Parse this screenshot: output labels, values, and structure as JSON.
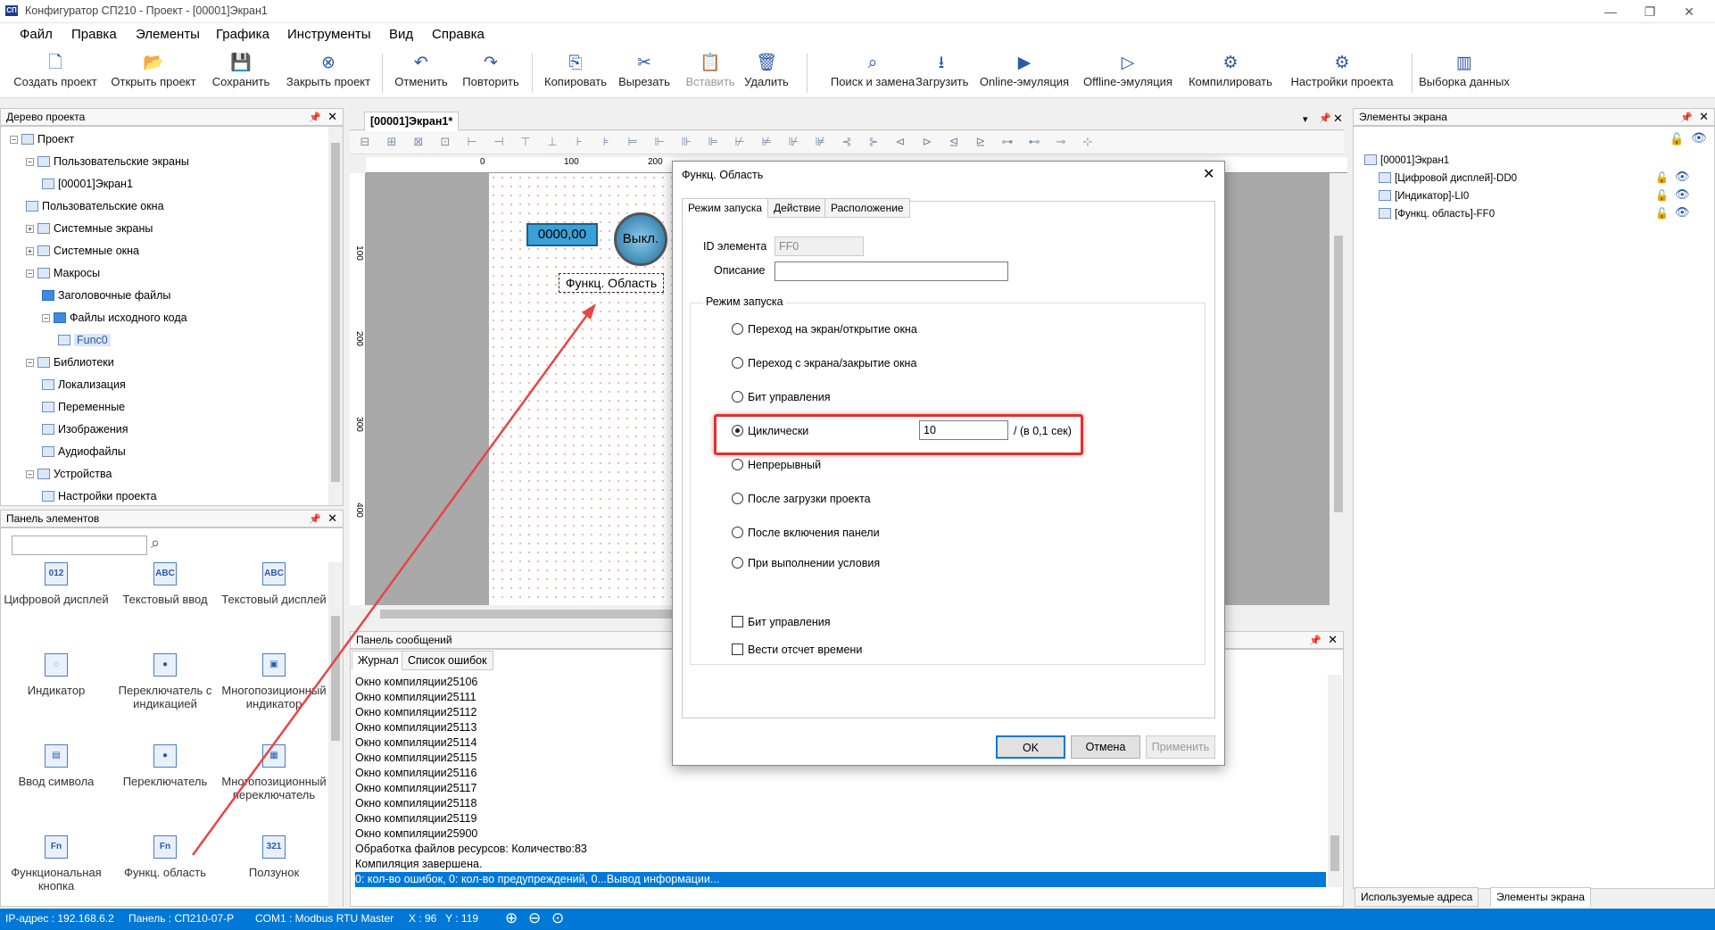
{
  "window": {
    "title": "Конфигуратор СП210 - Проект - [00001]Экран1",
    "app_icon": "СП",
    "controls": [
      "—",
      "❐",
      "✕"
    ]
  },
  "menu": [
    "Файл",
    "Правка",
    "Элементы",
    "Графика",
    "Инструменты",
    "Вид",
    "Справка"
  ],
  "toolbar": [
    {
      "label": "Создать проект",
      "icon": "new-project-icon",
      "glyph": "🗋"
    },
    {
      "label": "Открыть проект",
      "icon": "open-project-icon",
      "glyph": "📂"
    },
    {
      "label": "Сохранить",
      "icon": "save-icon",
      "glyph": "💾"
    },
    {
      "label": "Закрыть проект",
      "icon": "close-project-icon",
      "glyph": "⊗"
    },
    {
      "label": "Отменить",
      "icon": "undo-icon",
      "glyph": "↶"
    },
    {
      "label": "Повторить",
      "icon": "redo-icon",
      "glyph": "↷"
    },
    {
      "label": "Копировать",
      "icon": "copy-icon",
      "glyph": "⎘"
    },
    {
      "label": "Вырезать",
      "icon": "cut-icon",
      "glyph": "✂"
    },
    {
      "label": "Вставить",
      "icon": "paste-icon",
      "glyph": "📋",
      "disabled": true
    },
    {
      "label": "Удалить",
      "icon": "delete-icon",
      "glyph": "🗑"
    },
    {
      "label": "Поиск и замена",
      "icon": "search-replace-icon",
      "glyph": "⌕"
    },
    {
      "label": "Загрузить",
      "icon": "download-icon",
      "glyph": "⭳"
    },
    {
      "label": "Online-эмуляция",
      "icon": "online-emulation-icon",
      "glyph": "▶"
    },
    {
      "label": "Offline-эмуляция",
      "icon": "offline-emulation-icon",
      "glyph": "▷"
    },
    {
      "label": "Компилировать",
      "icon": "compile-icon",
      "glyph": "⚙"
    },
    {
      "label": "Настройки проекта",
      "icon": "project-settings-icon",
      "glyph": "⚙"
    },
    {
      "label": "Выборка данных",
      "icon": "data-sampling-icon",
      "glyph": "▥"
    }
  ],
  "project_tree": {
    "title": "Дерево проекта",
    "items": [
      {
        "label": "Проект",
        "level": 0,
        "expanded": true,
        "folder": false
      },
      {
        "label": "Пользовательские экраны",
        "level": 1,
        "expanded": true,
        "folder": false
      },
      {
        "label": "[00001]Экран1",
        "level": 2,
        "folder": false
      },
      {
        "label": "Пользовательские окна",
        "level": 1,
        "folder": false
      },
      {
        "label": "Системные экраны",
        "level": 1,
        "expanded": false,
        "folder": false
      },
      {
        "label": "Системные окна",
        "level": 1,
        "expanded": false,
        "folder": false
      },
      {
        "label": "Макросы",
        "level": 1,
        "expanded": true,
        "folder": false
      },
      {
        "label": "Заголовочные файлы",
        "level": 2,
        "folder": true
      },
      {
        "label": "Файлы исходного кода",
        "level": 2,
        "expanded": true,
        "folder": true
      },
      {
        "label": "Func0",
        "level": 3,
        "folder": false,
        "selected": true
      },
      {
        "label": "Библиотеки",
        "level": 1,
        "expanded": true,
        "folder": false
      },
      {
        "label": "Локализация",
        "level": 2,
        "folder": false
      },
      {
        "label": "Переменные",
        "level": 2,
        "folder": false
      },
      {
        "label": "Изображения",
        "level": 2,
        "folder": false
      },
      {
        "label": "Аудиофайлы",
        "level": 2,
        "folder": false
      },
      {
        "label": "Устройства",
        "level": 1,
        "expanded": true,
        "folder": false
      },
      {
        "label": "Настройки проекта",
        "level": 2,
        "folder": false
      }
    ]
  },
  "elements_panel": {
    "title": "Панель элементов",
    "search_placeholder": "",
    "items": [
      {
        "label": "Цифровой дисплей",
        "icon": "digital-display-icon",
        "glyph": "012"
      },
      {
        "label": "Текстовый ввод",
        "icon": "text-input-icon",
        "glyph": "ABC"
      },
      {
        "label": "Текстовый дисплей",
        "icon": "text-display-icon",
        "glyph": "ABC"
      },
      {
        "label": "Индикатор",
        "icon": "indicator-bulb-icon",
        "glyph": "◌"
      },
      {
        "label": "Переключатель с индикацией",
        "icon": "switch-indicator-icon",
        "glyph": "●"
      },
      {
        "label": "Многопозиционный индикатор",
        "icon": "multi-indicator-icon",
        "glyph": "▣"
      },
      {
        "label": "Ввод символа",
        "icon": "symbol-input-icon",
        "glyph": "▤"
      },
      {
        "label": "Переключатель",
        "icon": "switch-icon",
        "glyph": "●"
      },
      {
        "label": "Многопозиционный переключатель",
        "icon": "multi-switch-icon",
        "glyph": "▦"
      },
      {
        "label": "Функциональная кнопка",
        "icon": "function-button-icon",
        "glyph": "Fn"
      },
      {
        "label": "Функц. область",
        "icon": "function-area-icon",
        "glyph": "Fn"
      },
      {
        "label": "Ползунок",
        "icon": "slider-icon",
        "glyph": "321"
      }
    ]
  },
  "editor": {
    "tab": "[00001]Экран1*",
    "ruler_marks": [
      "0",
      "100",
      "200"
    ],
    "vruler_marks": [
      "100",
      "200",
      "300",
      "400"
    ],
    "digital_display_value": "0000,00",
    "switch_label": "Выкл.",
    "function_area_label": "Функц. Область"
  },
  "messages": {
    "title": "Панель сообщений",
    "tabs": [
      "Журнал",
      "Список ошибок"
    ],
    "lines": [
      "Окно компиляции25106",
      "Окно компиляции25111",
      "Окно компиляции25112",
      "Окно компиляции25113",
      "Окно компиляции25114",
      "Окно компиляции25115",
      "Окно компиляции25116",
      "Окно компиляции25117",
      "Окно компиляции25118",
      "Окно компиляции25119",
      "Окно компиляции25900",
      "Обработка файлов ресурсов: Количество:83",
      "Компиляция завершена.",
      "0: кол-во ошибок, 0: кол-во предупреждений, 0...Вывод информации..."
    ]
  },
  "screen_elements": {
    "title": "Элементы экрана",
    "items": [
      {
        "label": "[00001]Экран1",
        "level": 0
      },
      {
        "label": "[Цифровой дисплей]-DD0",
        "level": 1
      },
      {
        "label": "[Индикатор]-LI0",
        "level": 1
      },
      {
        "label": "[Функц. область]-FF0",
        "level": 1
      }
    ],
    "bottom_tabs": [
      "Используемые адреса",
      "Элементы экрана"
    ]
  },
  "dialog": {
    "title": "Функц. Область",
    "tabs": [
      "Режим запуска",
      "Действие",
      "Расположение"
    ],
    "id_label": "ID элемента",
    "id_value": "FF0",
    "desc_label": "Описание",
    "desc_value": "",
    "group_label": "Режим запуска",
    "options": [
      "Переход на экран/открытие окна",
      "Переход с экрана/закрытие окна",
      "Бит управления",
      "Циклически",
      "Непрерывный",
      "После загрузки проекта",
      "После включения панели",
      "При выполнении условия"
    ],
    "selected_option": 3,
    "cycle_value": "10",
    "cycle_unit": "/ (в 0,1 сек)",
    "checkboxes": [
      "Бит управления",
      "Вести отсчет времени"
    ],
    "buttons": {
      "ok": "OK",
      "cancel": "Отмена",
      "apply": "Применить"
    },
    "highlight_color": "#e03030"
  },
  "status": {
    "ip": "IP-адрес : 192.168.6.2",
    "panel": "Панель : СП210-07-Р",
    "com": "COM1 : Modbus RTU Master",
    "coords": "X : 96   Y : 119"
  }
}
